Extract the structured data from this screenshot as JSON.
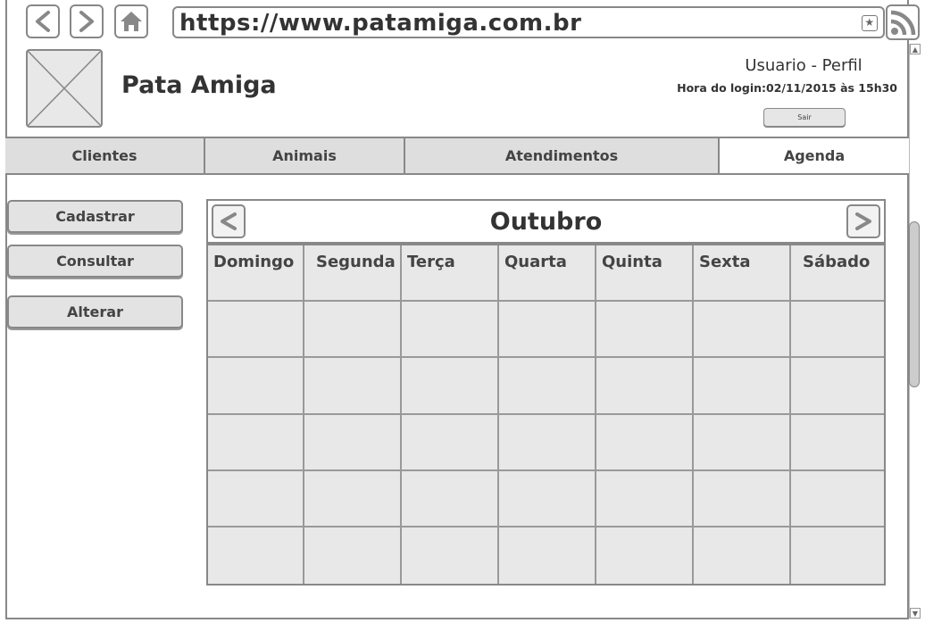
{
  "browser": {
    "url": "https://www.patamiga.com.br",
    "icons": [
      "back-icon",
      "forward-icon",
      "home-icon",
      "bookmark-star-icon",
      "rss-icon"
    ]
  },
  "header": {
    "app_title": "Pata Amiga",
    "user_profile": "Usuario - Perfil",
    "login_time": "Hora do login:02/11/2015 às 15h30",
    "logout_label": "Sair"
  },
  "tabs": [
    {
      "label": "Clientes",
      "active": false
    },
    {
      "label": "Animais",
      "active": false
    },
    {
      "label": "Atendimentos",
      "active": false
    },
    {
      "label": "Agenda",
      "active": true
    }
  ],
  "sidebar": {
    "buttons": [
      {
        "label": "Cadastrar"
      },
      {
        "label": "Consultar"
      },
      {
        "label": "Alterar"
      }
    ]
  },
  "calendar": {
    "month": "Outubro",
    "weekdays": [
      "Domingo",
      "Segunda",
      "Terça",
      "Quarta",
      "Quinta",
      "Sexta",
      "Sábado"
    ],
    "week_rows": 5
  },
  "colors": {
    "border": "#888888",
    "fill": "#e8e8e8",
    "text": "#333333"
  }
}
